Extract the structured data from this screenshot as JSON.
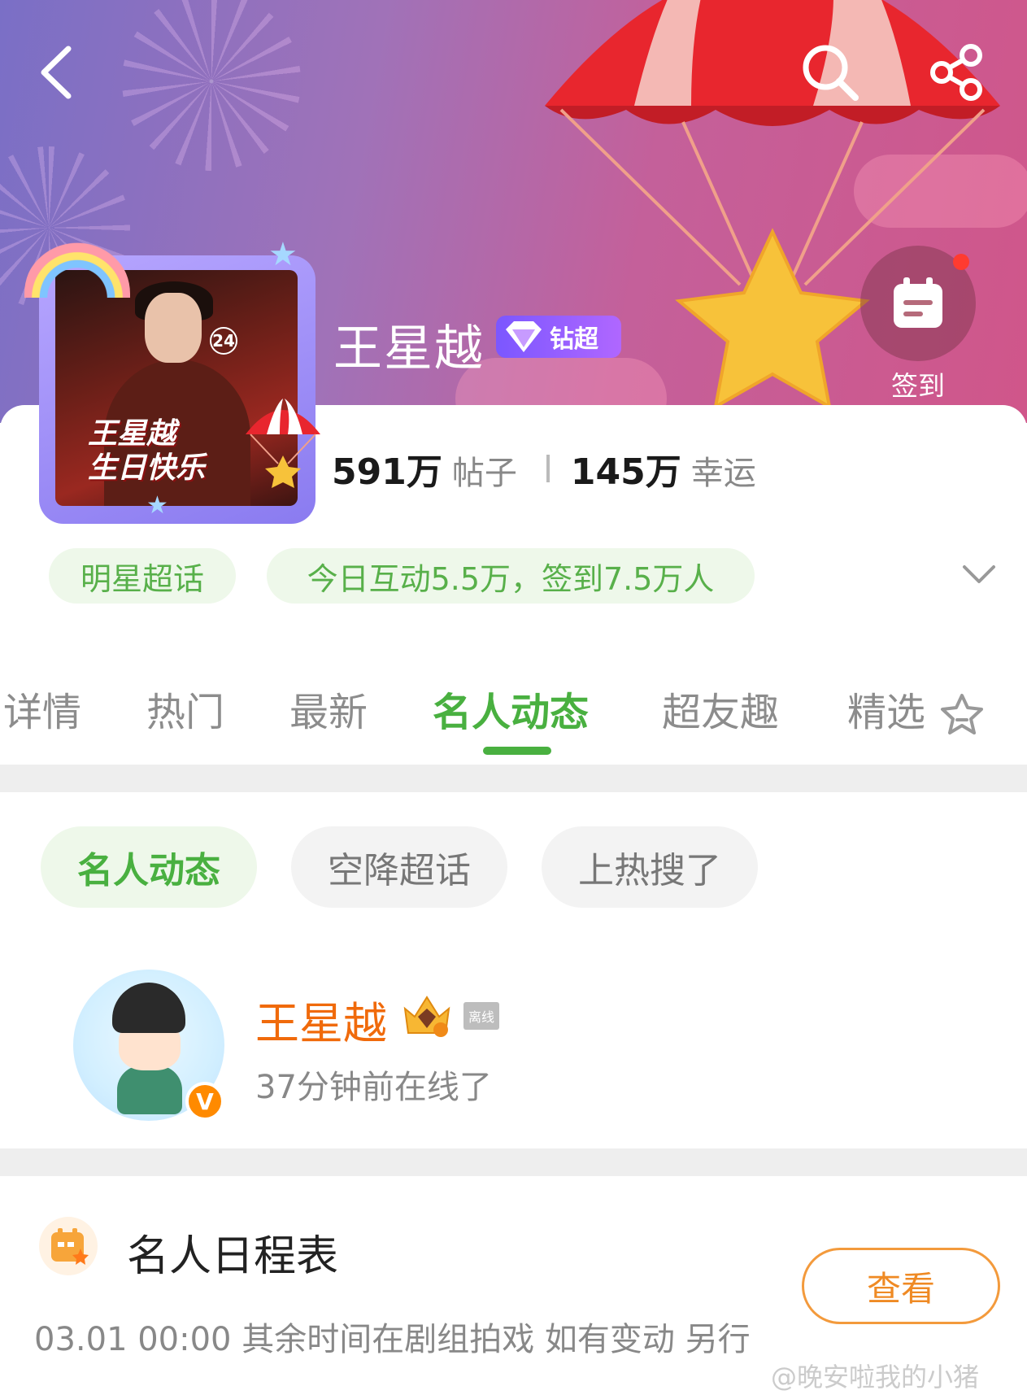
{
  "header": {
    "icons": {
      "back": "back-arrow-icon",
      "search": "search-icon",
      "share": "share-icon"
    },
    "checkin_label": "签到"
  },
  "topic": {
    "name": "王星越",
    "badge": "钻超",
    "avatar_caption": [
      "王星越",
      "生日快乐"
    ],
    "avatar_number": "24",
    "posts_count": "591万",
    "posts_label": "帖子",
    "luck_count": "145万",
    "luck_label": "幸运",
    "category_tag": "明星超话",
    "activity_info": "今日互动5.5万，签到7.5万人"
  },
  "tabs": [
    "详情",
    "热门",
    "最新",
    "名人动态",
    "超友趣",
    "精选"
  ],
  "active_tab": "名人动态",
  "subtabs": [
    "名人动态",
    "空降超话",
    "上热搜了"
  ],
  "active_subtab": "名人动态",
  "celeb": {
    "name": "王星越",
    "status_badge": "离线",
    "last_seen": "37分钟前在线了",
    "verify_mark": "V"
  },
  "schedule": {
    "title": "名人日程表",
    "view_button": "查看",
    "entry": "03.01 00:00 其余时间在剧组拍戏 如有变动 另行"
  },
  "watermark": "@晚安啦我的小猪",
  "colors": {
    "accent_green": "#49b040",
    "orange_name": "#f06a0b",
    "hero_gradient_start": "#7a6fc6",
    "hero_gradient_end": "#d0568a"
  }
}
